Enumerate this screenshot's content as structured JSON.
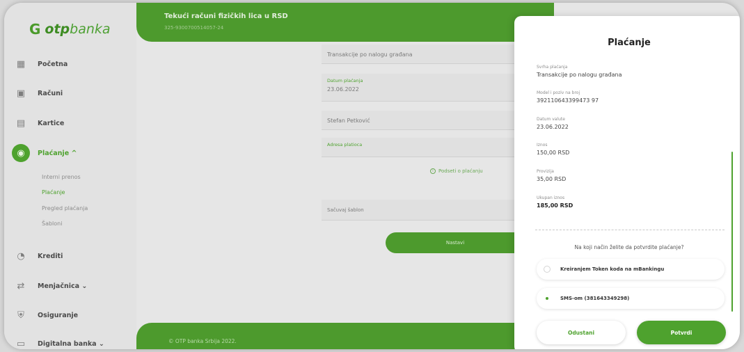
{
  "brand": {
    "mark": "G",
    "otp": "otp",
    "banka": "banka"
  },
  "sidebar": {
    "items": [
      {
        "label": "Početna",
        "icon": "home-icon"
      },
      {
        "label": "Računi",
        "icon": "accounts-icon"
      },
      {
        "label": "Kartice",
        "icon": "card-icon"
      },
      {
        "label": "Plaćanje ^",
        "icon": "payment-icon"
      },
      {
        "label": "Krediti",
        "icon": "loan-icon"
      },
      {
        "label": "Menjačnica ⌄",
        "icon": "exchange-icon"
      },
      {
        "label": "Osiguranje",
        "icon": "insurance-icon"
      },
      {
        "label": "Digitalna banka ⌄",
        "icon": "digital-icon"
      }
    ],
    "sub_items": [
      "Interni prenos",
      "Plaćanje",
      "Pregled plaćanja",
      "Šabloni"
    ]
  },
  "header": {
    "title": "Tekući računi fizičkih lica u RSD",
    "account": "325-9300700514057-24"
  },
  "form": {
    "purpose_value": "Transakcije po nalogu građana",
    "date_label": "Datum plaćanja",
    "date_value": "23.06.2022",
    "receiver_value": "Stefan Petković",
    "address_label": "Adresa platioca",
    "sign_link": "Podseti o plaćanju",
    "template_label": "Sačuvaj šablon",
    "continue": "Nastavi"
  },
  "footer": {
    "text": "© OTP banka Srbija 2022."
  },
  "modal": {
    "title": "Plaćanje",
    "rows": [
      {
        "label": "Svrha plaćanja",
        "value": "Transakcije po nalogu građana"
      },
      {
        "label": "Model i poziv na broj",
        "value": "392110643399473 97"
      },
      {
        "label": "Datum valute",
        "value": "23.06.2022"
      },
      {
        "label": "Iznos",
        "value": "150,00 RSD"
      },
      {
        "label": "Provizija",
        "value": "35,00 RSD"
      },
      {
        "label": "Ukupan iznos",
        "value": "185,00 RSD"
      }
    ],
    "question": "Na koji način želite da potvrdite plaćanje?",
    "options": [
      {
        "label": "Kreiranjem Token koda na mBankingu",
        "selected": false
      },
      {
        "label": "SMS-om (381643349298)",
        "selected": true
      }
    ],
    "cancel": "Odustani",
    "confirm": "Potvrdi"
  },
  "colors": {
    "accent": "#4ea22e",
    "header": "#4d9a2d"
  }
}
